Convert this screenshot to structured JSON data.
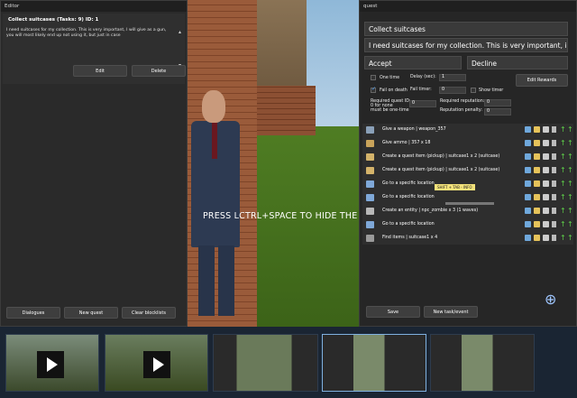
{
  "hint": "PRESS LCTRL+SPACE TO HIDE THE EDIT",
  "editor": {
    "title": "Editor",
    "quest_title": "Collect suitcases (Tasks: 9) ID: 1",
    "quest_desc": "I need suitcases for my collection. This is very important, I will give as a gun, you will most likely end up not using it, but just in case",
    "edit_label": "Edit",
    "delete_label": "Delete",
    "dialogues_label": "Dialogues",
    "new_quest_label": "New quest",
    "clear_blocklists_label": "Clear blocklists"
  },
  "quest": {
    "title": "quest",
    "name": "Collect suitcases",
    "description": "I need suitcases for my collection. This is very important, i will give a",
    "accept": "Accept",
    "decline": "Decline",
    "one_time_label": "One time",
    "delay_label": "Delay (sec):",
    "delay_value": "1",
    "fail_death_label": "Fail on death",
    "fail_timer_label": "Fail timer:",
    "fail_timer_value": "0",
    "show_timer_label": "Show timer",
    "edit_rewards_label": "Edit Rewards",
    "req_quest_label_1": "Required quest ID:",
    "req_quest_label_2": "0 for none",
    "req_quest_label_3": "must be one-time",
    "req_quest_value": "0",
    "req_rep_label": "Required reputation:",
    "req_rep_value": "0",
    "rep_penalty_label": "Reputation penalty:",
    "rep_penalty_value": "0",
    "save_label": "Save",
    "new_task_label": "New task/event",
    "tooltip": "SHIFT + TAB - INFO",
    "tasks": [
      {
        "text": "Give a weapon | weapon_357",
        "icon_color": "#8aa0b8"
      },
      {
        "text": "Give ammo | 357 x 18",
        "icon_color": "#c9a35a"
      },
      {
        "text": "Create a quest item (pickup) | suitcase1 x 2 (suitcase)",
        "icon_color": "#d4b36a"
      },
      {
        "text": "Create a quest item (pickup) | suitcase1 x 2 (suitcase)",
        "icon_color": "#d4b36a"
      },
      {
        "text": "Go to a specific location",
        "icon_color": "#7fa8d8"
      },
      {
        "text": "Go to a specific location",
        "icon_color": "#7fa8d8"
      },
      {
        "text": "Create an entity | npc_zombie x 3 (1 waves)",
        "icon_color": "#b8b8b8"
      },
      {
        "text": "Go to a specific location",
        "icon_color": "#7fa8d8"
      },
      {
        "text": "Find items | suitcase1 x 4",
        "icon_color": "#9a9a9a"
      }
    ]
  }
}
